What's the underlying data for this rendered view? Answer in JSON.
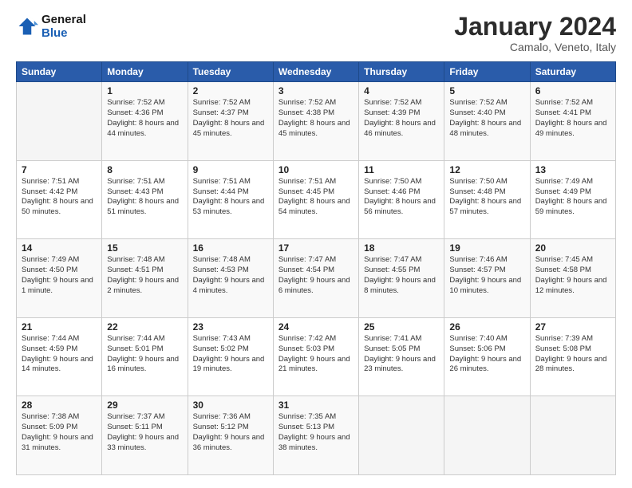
{
  "header": {
    "logo": {
      "line1": "General",
      "line2": "Blue"
    },
    "title": "January 2024",
    "subtitle": "Camalo, Veneto, Italy"
  },
  "calendar": {
    "weekdays": [
      "Sunday",
      "Monday",
      "Tuesday",
      "Wednesday",
      "Thursday",
      "Friday",
      "Saturday"
    ],
    "weeks": [
      [
        {
          "day": "",
          "sunrise": "",
          "sunset": "",
          "daylight": ""
        },
        {
          "day": "1",
          "sunrise": "Sunrise: 7:52 AM",
          "sunset": "Sunset: 4:36 PM",
          "daylight": "Daylight: 8 hours and 44 minutes."
        },
        {
          "day": "2",
          "sunrise": "Sunrise: 7:52 AM",
          "sunset": "Sunset: 4:37 PM",
          "daylight": "Daylight: 8 hours and 45 minutes."
        },
        {
          "day": "3",
          "sunrise": "Sunrise: 7:52 AM",
          "sunset": "Sunset: 4:38 PM",
          "daylight": "Daylight: 8 hours and 45 minutes."
        },
        {
          "day": "4",
          "sunrise": "Sunrise: 7:52 AM",
          "sunset": "Sunset: 4:39 PM",
          "daylight": "Daylight: 8 hours and 46 minutes."
        },
        {
          "day": "5",
          "sunrise": "Sunrise: 7:52 AM",
          "sunset": "Sunset: 4:40 PM",
          "daylight": "Daylight: 8 hours and 48 minutes."
        },
        {
          "day": "6",
          "sunrise": "Sunrise: 7:52 AM",
          "sunset": "Sunset: 4:41 PM",
          "daylight": "Daylight: 8 hours and 49 minutes."
        }
      ],
      [
        {
          "day": "7",
          "sunrise": "Sunrise: 7:51 AM",
          "sunset": "Sunset: 4:42 PM",
          "daylight": "Daylight: 8 hours and 50 minutes."
        },
        {
          "day": "8",
          "sunrise": "Sunrise: 7:51 AM",
          "sunset": "Sunset: 4:43 PM",
          "daylight": "Daylight: 8 hours and 51 minutes."
        },
        {
          "day": "9",
          "sunrise": "Sunrise: 7:51 AM",
          "sunset": "Sunset: 4:44 PM",
          "daylight": "Daylight: 8 hours and 53 minutes."
        },
        {
          "day": "10",
          "sunrise": "Sunrise: 7:51 AM",
          "sunset": "Sunset: 4:45 PM",
          "daylight": "Daylight: 8 hours and 54 minutes."
        },
        {
          "day": "11",
          "sunrise": "Sunrise: 7:50 AM",
          "sunset": "Sunset: 4:46 PM",
          "daylight": "Daylight: 8 hours and 56 minutes."
        },
        {
          "day": "12",
          "sunrise": "Sunrise: 7:50 AM",
          "sunset": "Sunset: 4:48 PM",
          "daylight": "Daylight: 8 hours and 57 minutes."
        },
        {
          "day": "13",
          "sunrise": "Sunrise: 7:49 AM",
          "sunset": "Sunset: 4:49 PM",
          "daylight": "Daylight: 8 hours and 59 minutes."
        }
      ],
      [
        {
          "day": "14",
          "sunrise": "Sunrise: 7:49 AM",
          "sunset": "Sunset: 4:50 PM",
          "daylight": "Daylight: 9 hours and 1 minute."
        },
        {
          "day": "15",
          "sunrise": "Sunrise: 7:48 AM",
          "sunset": "Sunset: 4:51 PM",
          "daylight": "Daylight: 9 hours and 2 minutes."
        },
        {
          "day": "16",
          "sunrise": "Sunrise: 7:48 AM",
          "sunset": "Sunset: 4:53 PM",
          "daylight": "Daylight: 9 hours and 4 minutes."
        },
        {
          "day": "17",
          "sunrise": "Sunrise: 7:47 AM",
          "sunset": "Sunset: 4:54 PM",
          "daylight": "Daylight: 9 hours and 6 minutes."
        },
        {
          "day": "18",
          "sunrise": "Sunrise: 7:47 AM",
          "sunset": "Sunset: 4:55 PM",
          "daylight": "Daylight: 9 hours and 8 minutes."
        },
        {
          "day": "19",
          "sunrise": "Sunrise: 7:46 AM",
          "sunset": "Sunset: 4:57 PM",
          "daylight": "Daylight: 9 hours and 10 minutes."
        },
        {
          "day": "20",
          "sunrise": "Sunrise: 7:45 AM",
          "sunset": "Sunset: 4:58 PM",
          "daylight": "Daylight: 9 hours and 12 minutes."
        }
      ],
      [
        {
          "day": "21",
          "sunrise": "Sunrise: 7:44 AM",
          "sunset": "Sunset: 4:59 PM",
          "daylight": "Daylight: 9 hours and 14 minutes."
        },
        {
          "day": "22",
          "sunrise": "Sunrise: 7:44 AM",
          "sunset": "Sunset: 5:01 PM",
          "daylight": "Daylight: 9 hours and 16 minutes."
        },
        {
          "day": "23",
          "sunrise": "Sunrise: 7:43 AM",
          "sunset": "Sunset: 5:02 PM",
          "daylight": "Daylight: 9 hours and 19 minutes."
        },
        {
          "day": "24",
          "sunrise": "Sunrise: 7:42 AM",
          "sunset": "Sunset: 5:03 PM",
          "daylight": "Daylight: 9 hours and 21 minutes."
        },
        {
          "day": "25",
          "sunrise": "Sunrise: 7:41 AM",
          "sunset": "Sunset: 5:05 PM",
          "daylight": "Daylight: 9 hours and 23 minutes."
        },
        {
          "day": "26",
          "sunrise": "Sunrise: 7:40 AM",
          "sunset": "Sunset: 5:06 PM",
          "daylight": "Daylight: 9 hours and 26 minutes."
        },
        {
          "day": "27",
          "sunrise": "Sunrise: 7:39 AM",
          "sunset": "Sunset: 5:08 PM",
          "daylight": "Daylight: 9 hours and 28 minutes."
        }
      ],
      [
        {
          "day": "28",
          "sunrise": "Sunrise: 7:38 AM",
          "sunset": "Sunset: 5:09 PM",
          "daylight": "Daylight: 9 hours and 31 minutes."
        },
        {
          "day": "29",
          "sunrise": "Sunrise: 7:37 AM",
          "sunset": "Sunset: 5:11 PM",
          "daylight": "Daylight: 9 hours and 33 minutes."
        },
        {
          "day": "30",
          "sunrise": "Sunrise: 7:36 AM",
          "sunset": "Sunset: 5:12 PM",
          "daylight": "Daylight: 9 hours and 36 minutes."
        },
        {
          "day": "31",
          "sunrise": "Sunrise: 7:35 AM",
          "sunset": "Sunset: 5:13 PM",
          "daylight": "Daylight: 9 hours and 38 minutes."
        },
        {
          "day": "",
          "sunrise": "",
          "sunset": "",
          "daylight": ""
        },
        {
          "day": "",
          "sunrise": "",
          "sunset": "",
          "daylight": ""
        },
        {
          "day": "",
          "sunrise": "",
          "sunset": "",
          "daylight": ""
        }
      ]
    ]
  }
}
